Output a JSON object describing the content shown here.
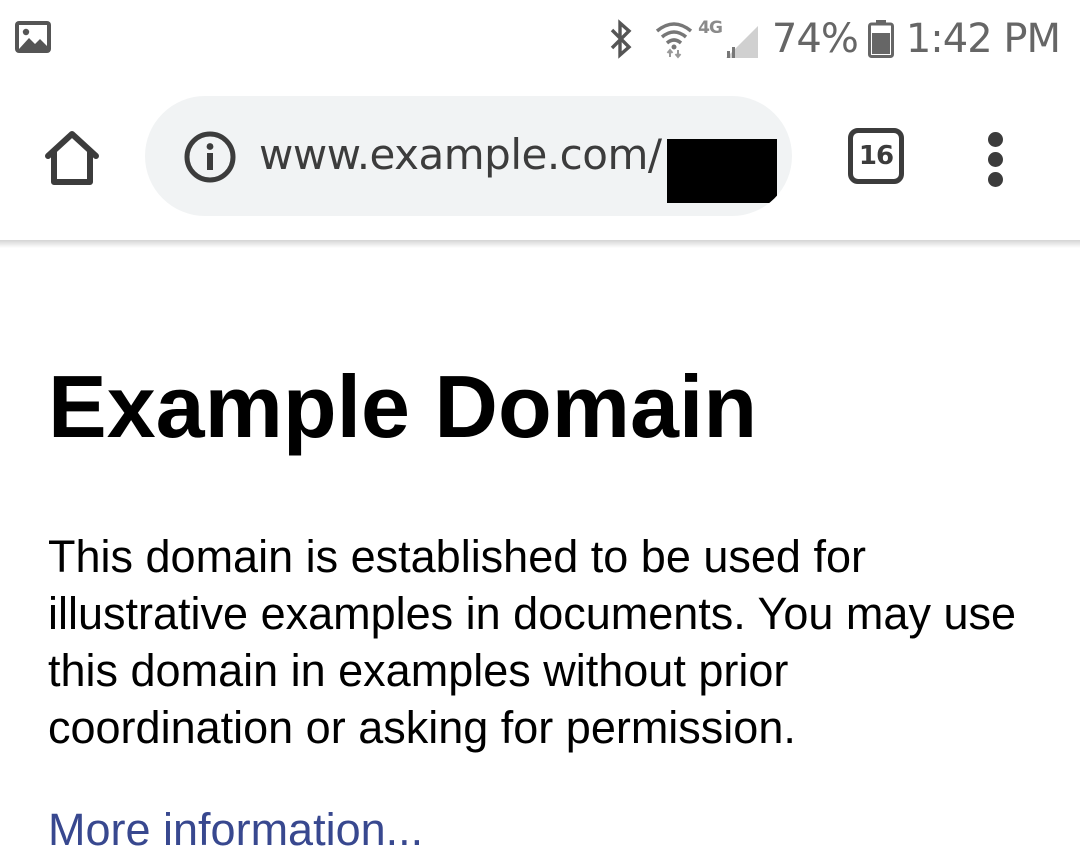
{
  "status_bar": {
    "network_type": "4G",
    "battery_percent": "74%",
    "time": "1:42 PM",
    "icons": [
      "gallery-notification-icon",
      "bluetooth-icon",
      "wifi-icon",
      "signal-icon",
      "battery-icon"
    ]
  },
  "toolbar": {
    "url": "www.example.com/",
    "tab_count": "16",
    "icons": [
      "home-icon",
      "info-icon",
      "tab-switcher-icon",
      "more-vert-icon"
    ]
  },
  "page": {
    "heading": "Example Domain",
    "paragraph": "This domain is established to be used for illustrative examples in documents. You may use this domain in examples without prior coordination or asking for permission.",
    "link_text": "More information...",
    "link_color": "#38488f"
  },
  "colors": {
    "omnibox_bg": "#f1f3f4",
    "icon_color": "#3c3c3c",
    "status_text": "#666666"
  }
}
